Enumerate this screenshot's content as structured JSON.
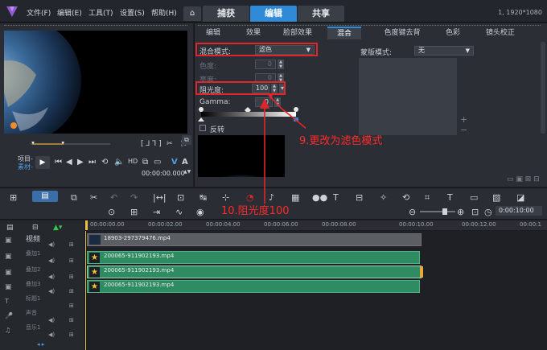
{
  "app": {
    "menus": [
      "文件(F)",
      "编辑(E)",
      "工具(T)",
      "设置(S)",
      "帮助(H)"
    ],
    "main_tabs": [
      "捕获",
      "编辑",
      "共享"
    ],
    "resolution": "1, 1920*1080"
  },
  "preview": {
    "mode_project": "项目-",
    "mode_clip": "素材-",
    "timecode": "00:00:00.000"
  },
  "effects": {
    "sub_tabs": [
      "编辑",
      "效果",
      "脸部效果",
      "混合",
      "色度键去背",
      "色彩",
      "镜头校正"
    ],
    "blend_mode_label": "混合模式:",
    "blend_mode_value": "滤色",
    "hue_label": "色度:",
    "hue_value": "0",
    "luma_label": "亮度:",
    "luma_value": "0",
    "opacity_label": "阻光度:",
    "opacity_value": "100",
    "gamma_label": "Gamma:",
    "gamma_value": "0",
    "invert_label": "反转",
    "mask_mode_label": "蒙版模式:",
    "mask_mode_value": "无"
  },
  "annotations": {
    "step9": "9.更改为滤色模式",
    "step10": "10.阻光度100"
  },
  "timeline": {
    "timecode": "0:00:10:00",
    "ruler": [
      "00:00:00.00",
      "00:00:02.00",
      "00:00:04.00",
      "00:00:06.00",
      "00:00:08.00",
      "00:00:10.00",
      "00:00:12.00",
      "00:00:1"
    ],
    "track_names": [
      "视频",
      "叠加1",
      "叠加2",
      "叠加3",
      "标题1",
      "声音",
      "音乐1"
    ],
    "clips": [
      {
        "name": "18903-297379476.mp4"
      },
      {
        "name": "200065-911902193.mp4"
      },
      {
        "name": "200065-911902193.mp4"
      },
      {
        "name": "200065-911902193.mp4"
      }
    ]
  }
}
